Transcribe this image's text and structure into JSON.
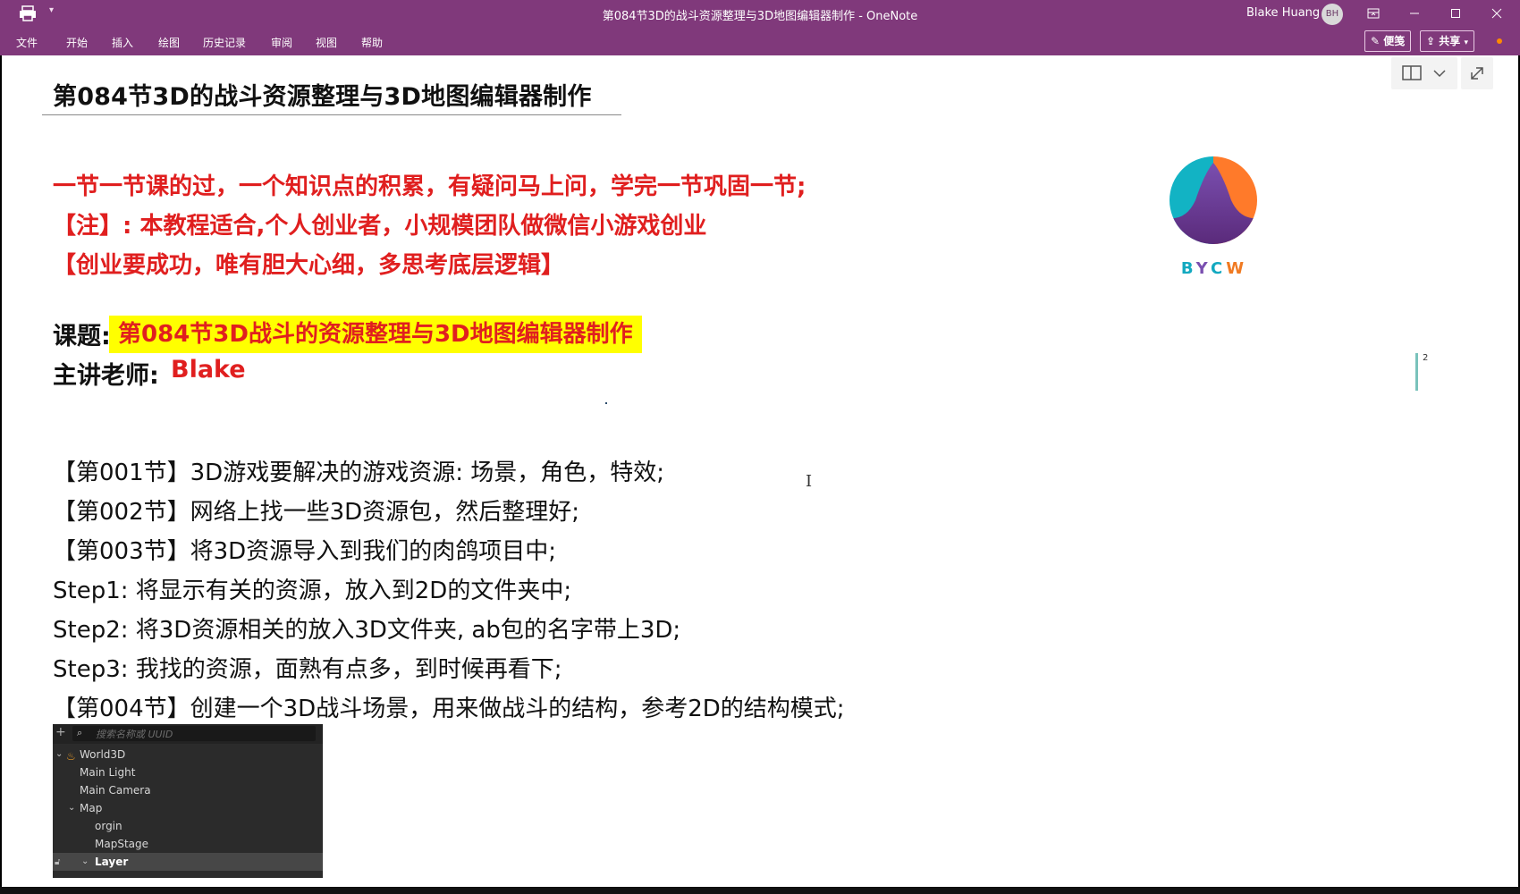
{
  "window": {
    "title": "第084节3D的战斗资源整理与3D地图编辑器制作  -  OneNote",
    "user_name": "Blake Huang",
    "user_initials": "BH",
    "qat_caret": "▾"
  },
  "ribbon": {
    "tabs": [
      "文件",
      "开始",
      "插入",
      "绘图",
      "历史记录",
      "审阅",
      "视图",
      "帮助"
    ],
    "sticky_notes": "便笺",
    "share": "共享"
  },
  "page": {
    "title": "第084节3D的战斗资源整理与3D地图编辑器制作",
    "red_lines": [
      "一节一节课的过，一个知识点的积累，有疑问马上问，学完一节巩固一节;",
      "【注】: 本教程适合,个人创业者，小规模团队做微信小游戏创业",
      "【创业要成功，唯有胆大心细，多思考底层逻辑】"
    ],
    "topic_label": "课题:",
    "topic_value": "第084节3D战斗的资源整理与3D地图编辑器制作",
    "teacher_label": "主讲老师:",
    "teacher_name": "Blake",
    "lines": [
      "【第001节】3D游戏要解决的游戏资源: 场景，角色，特效;",
      "【第002节】网络上找一些3D资源包，然后整理好;",
      "【第003节】将3D资源导入到我们的肉鸽项目中;",
      "Step1: 将显示有关的资源，放入到2D的文件夹中;",
      "Step2: 将3D资源相关的放入3D文件夹, ab包的名字带上3D;",
      "Step3: 我找的资源，面熟有点多，到时候再看下;",
      "【第004节】创建一个3D战斗场景，用来做战斗的结构，参考2D的结构模式;"
    ],
    "page_marker": "2",
    "logo_text": "BYCW"
  },
  "hierarchy": {
    "search_placeholder": "搜索名称或 UUID",
    "nodes": [
      {
        "label": "World3D",
        "depth": 0,
        "expanded": true
      },
      {
        "label": "Main Light",
        "depth": 1
      },
      {
        "label": "Main Camera",
        "depth": 1
      },
      {
        "label": "Map",
        "depth": 1,
        "expanded": true
      },
      {
        "label": "orgin",
        "depth": 2
      },
      {
        "label": "MapStage",
        "depth": 2
      },
      {
        "label": "Layer",
        "depth": 2,
        "expanded": true,
        "selected": true
      }
    ]
  },
  "colors": {
    "ribbon": "#80397b",
    "red_text": "#e01f1f",
    "highlight": "#ffff00"
  }
}
